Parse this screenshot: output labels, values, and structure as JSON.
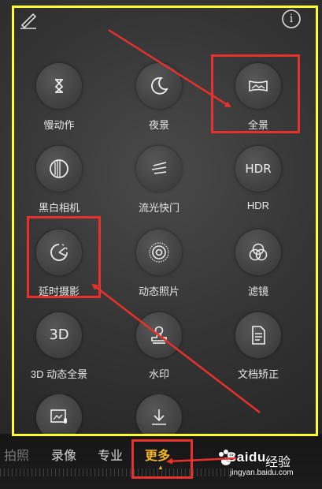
{
  "top_bar": {
    "edit_icon": "pencil-icon",
    "info_icon": "info-icon",
    "info_glyph": "i"
  },
  "modes": [
    {
      "label": "慢动作",
      "icon": "hourglass-icon"
    },
    {
      "label": "夜景",
      "icon": "moon-icon"
    },
    {
      "label": "全景",
      "icon": "panorama-icon"
    },
    {
      "label": "黑白相机",
      "icon": "mono-lens-icon"
    },
    {
      "label": "流光快门",
      "icon": "light-trail-icon"
    },
    {
      "label": "HDR",
      "icon": "hdr-icon",
      "icon_text": "HDR"
    },
    {
      "label": "延时摄影",
      "icon": "timelapse-icon"
    },
    {
      "label": "动态照片",
      "icon": "live-photo-icon"
    },
    {
      "label": "滤镜",
      "icon": "filter-icon"
    },
    {
      "label": "3D 动态全景",
      "icon": "3d-icon",
      "icon_text": "3D"
    },
    {
      "label": "水印",
      "icon": "stamp-icon"
    },
    {
      "label": "文档矫正",
      "icon": "document-icon"
    },
    {
      "label": "",
      "icon": "photo-audio-icon"
    },
    {
      "label": "",
      "icon": "download-icon"
    }
  ],
  "tabs": [
    {
      "label": "拍照"
    },
    {
      "label": "录像"
    },
    {
      "label": "专业"
    },
    {
      "label": "更多",
      "active": true
    }
  ],
  "tab_indicator": "▲",
  "watermark": {
    "brand": "Baidu",
    "sub": "经验",
    "url": "jingyan.baidu.com"
  },
  "colors": {
    "highlight_frame": "#ffff2a",
    "annotation_red": "#e8302c",
    "active_tab": "#f5b529"
  }
}
